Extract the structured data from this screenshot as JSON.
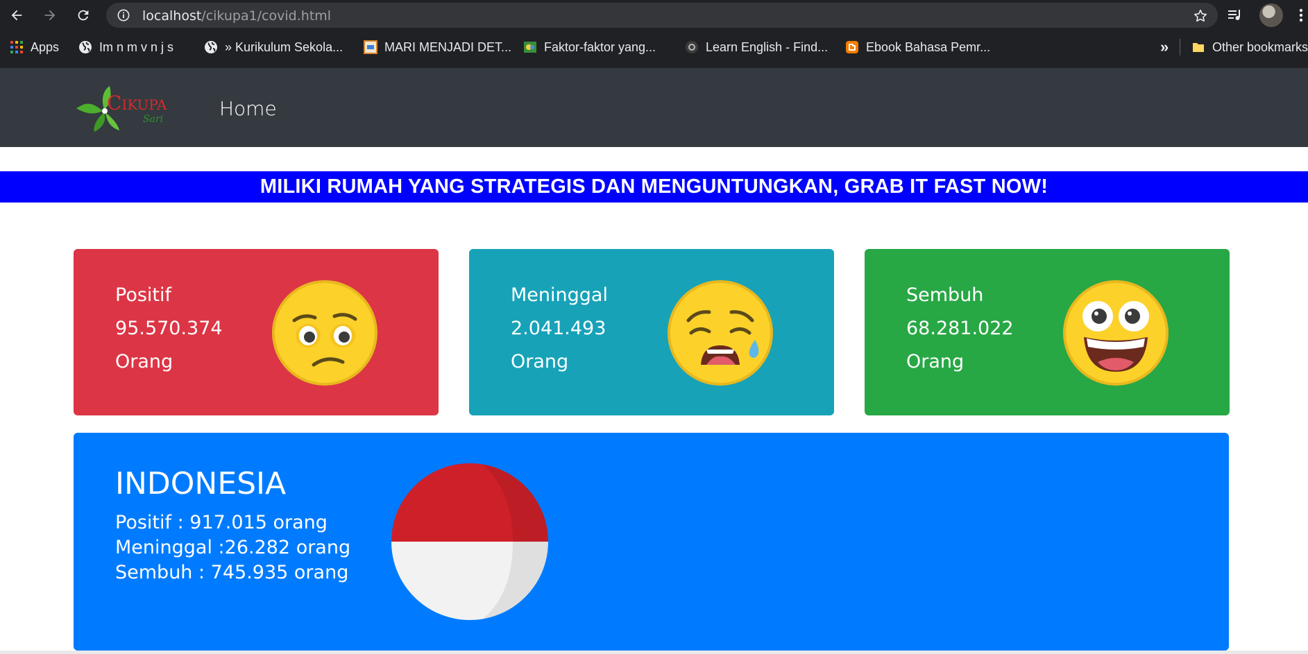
{
  "browser": {
    "url_host": "localhost",
    "url_path": "/cikupa1/covid.html",
    "bookmarks": [
      {
        "label": "Apps",
        "icon": "apps-grid-icon"
      },
      {
        "label": "Im   n m v n   j   s",
        "icon": "globe-icon"
      },
      {
        "label": "» Kurikulum Sekola...",
        "icon": "globe-icon"
      },
      {
        "label": "MARI MENJADI DET...",
        "icon": "site-favicon"
      },
      {
        "label": "Faktor-faktor yang...",
        "icon": "site-favicon"
      },
      {
        "label": "Learn English - Find...",
        "icon": "site-favicon"
      },
      {
        "label": "Ebook Bahasa Pemr...",
        "icon": "blogger-icon"
      }
    ],
    "overflow_label": "»",
    "other_bookmarks_label": "Other bookmarks"
  },
  "navbar": {
    "logo_text": "Cikupa",
    "logo_subtext": "Sari",
    "home_label": "Home"
  },
  "marquee_text": "MILIKI RUMAH YANG STRATEGIS DAN MENGUNTUNGKAN, GRAB IT FAST NOW!",
  "global_stats": [
    {
      "label": "Positif",
      "value": "95.570.374",
      "unit": "Orang",
      "icon": "worried-face-emoji-icon",
      "color": "#dc3545"
    },
    {
      "label": "Meninggal",
      "value": "2.041.493",
      "unit": "Orang",
      "icon": "crying-face-emoji-icon",
      "color": "#17a2b8"
    },
    {
      "label": "Sembuh",
      "value": "68.281.022",
      "unit": "Orang",
      "icon": "grinning-face-emoji-icon",
      "color": "#28a745"
    }
  ],
  "indonesia": {
    "title": "INDONESIA",
    "positif": "Positif : 917.015 orang",
    "meninggal": "Meninggal :26.282 orang",
    "sembuh": "Sembuh : 745.935 orang",
    "flag_icon": "indonesia-flag-icon",
    "color": "#007bff"
  }
}
